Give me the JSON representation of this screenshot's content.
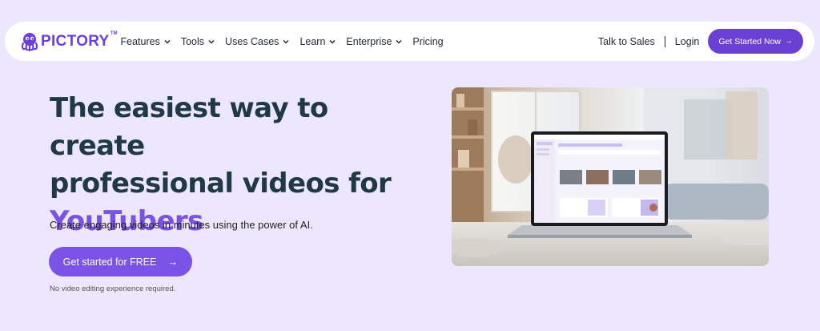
{
  "nav": {
    "logo_text": "PICTORY",
    "logo_tm": "TM",
    "items": [
      {
        "label": "Features",
        "dropdown": true
      },
      {
        "label": "Tools",
        "dropdown": true
      },
      {
        "label": "Uses Cases",
        "dropdown": true
      },
      {
        "label": "Learn",
        "dropdown": true
      },
      {
        "label": "Enterprise",
        "dropdown": true
      },
      {
        "label": "Pricing",
        "dropdown": false
      }
    ],
    "talk_to_sales": "Talk to Sales",
    "login": "Login",
    "get_started": "Get Started Now",
    "get_started_arrow": "→"
  },
  "hero": {
    "title_line1": "The easiest way to create",
    "title_line2": "professional videos for",
    "title_accent": "YouTubers",
    "subtitle": "Create engaging videos in minutes using the power of AI.",
    "cta_label": "Get started for FREE",
    "cta_arrow": "→",
    "note": "No video editing experience required."
  },
  "colors": {
    "page_background": "#ece7fd",
    "brand_purple": "#6a3fd4",
    "accent_purple": "#7b52e6",
    "heading_dark": "#1f3a44"
  },
  "icons": {
    "logo": "octopus-logo-icon",
    "dropdown": "chevron-down-icon",
    "arrow": "arrow-right-icon"
  }
}
